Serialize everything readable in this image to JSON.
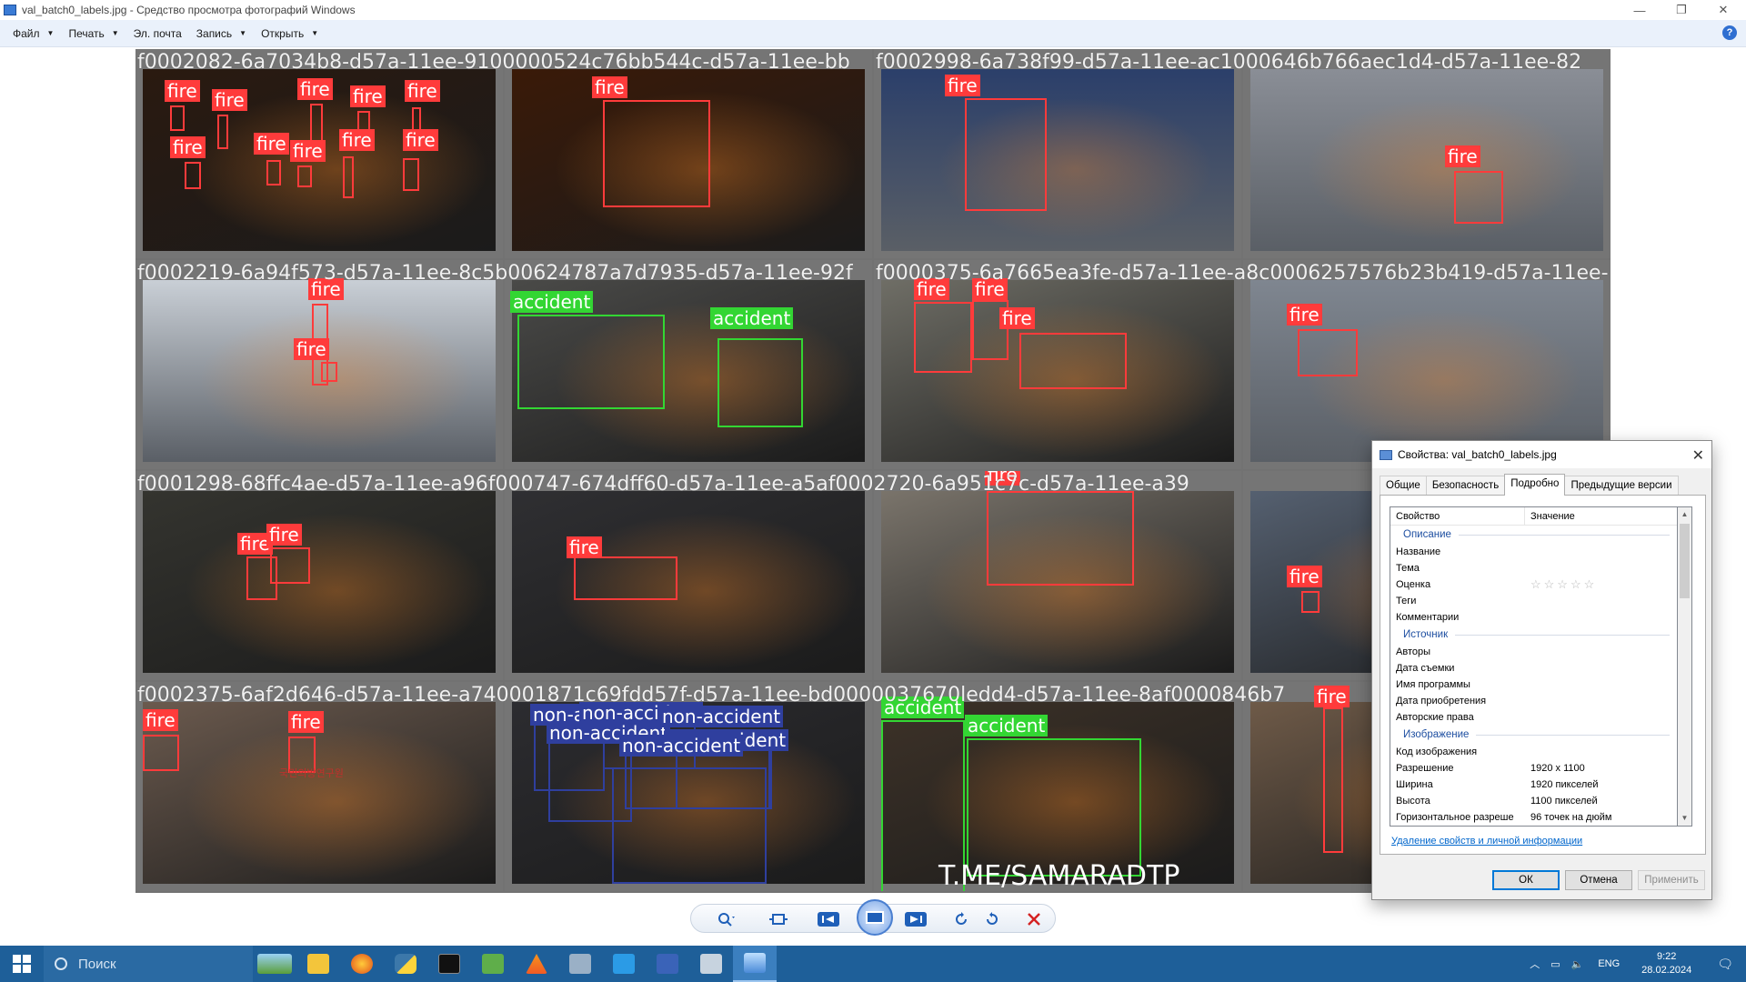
{
  "window": {
    "title": "val_batch0_labels.jpg - Средство просмотра фотографий Windows",
    "minimize": "—",
    "restore": "❐",
    "close": "✕"
  },
  "menu": {
    "items": [
      "Файл",
      "Печать",
      "Эл. почта",
      "Запись",
      "Открыть"
    ],
    "help": "?"
  },
  "mosaic": {
    "tiles": [
      {
        "caption": "f0002082-6a7034b8-d57a-11ee-9100000524c76bb544c-d57a-11ee-bb",
        "scene": "#2a1a10",
        "labels": [
          {
            "text": "fire",
            "cls": "fire"
          },
          {
            "text": "fire",
            "cls": "fire"
          },
          {
            "text": "fire",
            "cls": "fire"
          },
          {
            "text": "fire",
            "cls": "fire"
          },
          {
            "text": "fire",
            "cls": "fire"
          },
          {
            "text": "fire",
            "cls": "fire"
          },
          {
            "text": "fire",
            "cls": "fire"
          },
          {
            "text": "fire",
            "cls": "fire"
          },
          {
            "text": "fire",
            "cls": "fire"
          },
          {
            "text": "fire",
            "cls": "fire"
          }
        ]
      },
      {
        "caption": "",
        "scene": "#3a1a08",
        "labels": [
          {
            "text": "fire",
            "cls": "fire"
          }
        ]
      },
      {
        "caption": "f0002998-6a738f99-d57a-11ee-ac1000646b766aec1d4-d57a-11ee-82",
        "scene": "#2b3f6a",
        "labels": [
          {
            "text": "fire",
            "cls": "fire"
          }
        ]
      },
      {
        "caption": "",
        "scene": "#8a8e96",
        "labels": [
          {
            "text": "fire",
            "cls": "fire"
          }
        ]
      },
      {
        "caption": "f0002219-6a94f573-d57a-11ee-8c5b00624787a7d7935-d57a-11ee-92f",
        "scene": "#c9cfd6",
        "labels": [
          {
            "text": "fire",
            "cls": "fire"
          },
          {
            "text": "fire",
            "cls": "fire"
          }
        ]
      },
      {
        "caption": "",
        "scene": "#4a4a48",
        "labels": [
          {
            "text": "accident",
            "cls": "accident"
          },
          {
            "text": "accident",
            "cls": "accident"
          }
        ]
      },
      {
        "caption": "f0000375-6a7665ea3fe-d57a-11ee-a8c0006257576b23b419-d57a-11ee-aa",
        "scene": "#6f6e66",
        "labels": [
          {
            "text": "fire",
            "cls": "fire"
          },
          {
            "text": "fire",
            "cls": "fire"
          },
          {
            "text": "fire",
            "cls": "fire"
          }
        ]
      },
      {
        "caption": "",
        "scene": "#7f8690",
        "labels": [
          {
            "text": "fire",
            "cls": "fire"
          }
        ]
      },
      {
        "caption": "f0001298-68ffc4ae-d57a-11ee-a96f000747-674dff60-d57a-11ee-a5af0002720-6a951c7c-d57a-11ee-a39",
        "scene": "#34342f",
        "labels": [
          {
            "text": "fire",
            "cls": "fire"
          },
          {
            "text": "fire",
            "cls": "fire"
          }
        ]
      },
      {
        "caption": "",
        "scene": "#2f2f32",
        "labels": [
          {
            "text": "fire",
            "cls": "fire"
          }
        ]
      },
      {
        "caption": "",
        "scene": "#7a746b",
        "labels": [
          {
            "text": "fire",
            "cls": "fire"
          }
        ]
      },
      {
        "caption": "",
        "scene": "#556070",
        "labels": [
          {
            "text": "fire",
            "cls": "fire"
          }
        ]
      },
      {
        "caption": "f0002375-6af2d646-d57a-11ee-a740001871c69fdd57f-d57a-11ee-bd0000037670ledd4-d57a-11ee-8af0000846b7",
        "scene": "#6b5a4e",
        "labels": [
          {
            "text": "fire",
            "cls": "fire"
          },
          {
            "text": "fire",
            "cls": "fire"
          }
        ]
      },
      {
        "caption": "",
        "scene": "#2c2c30",
        "labels": [
          {
            "text": "non-accident",
            "cls": "non"
          },
          {
            "text": "non-accident",
            "cls": "non"
          },
          {
            "text": "non-accident",
            "cls": "non"
          },
          {
            "text": "non-accident",
            "cls": "non"
          },
          {
            "text": "non-accident",
            "cls": "non"
          },
          {
            "text": "non-accident",
            "cls": "non"
          }
        ]
      },
      {
        "caption": "",
        "scene": "#3d3228",
        "labels": [
          {
            "text": "accident",
            "cls": "accident"
          },
          {
            "text": "accident",
            "cls": "accident"
          }
        ]
      },
      {
        "caption": "",
        "scene": "#6e5a48",
        "labels": [
          {
            "text": "fire",
            "cls": "fire"
          }
        ]
      }
    ],
    "watermark": "T.ME/SAMARADTP",
    "sign": "국민의방연구원"
  },
  "toolbar": {
    "zoom": "zoom-icon",
    "fit": "fit-icon",
    "prev": "prev-icon",
    "slideshow": "slideshow-icon",
    "next": "next-icon",
    "rotate_left": "rotate-left-icon",
    "rotate_right": "rotate-right-icon",
    "delete": "delete-icon"
  },
  "dialog": {
    "title": "Свойства: val_batch0_labels.jpg",
    "tabs": [
      "Общие",
      "Безопасность",
      "Подробно",
      "Предыдущие версии"
    ],
    "active_tab": "Подробно",
    "columns": [
      "Свойство",
      "Значение"
    ],
    "sections": [
      {
        "name": "Описание",
        "rows": [
          {
            "k": "Название",
            "v": ""
          },
          {
            "k": "Тема",
            "v": ""
          },
          {
            "k": "Оценка",
            "v": "☆☆☆☆☆"
          },
          {
            "k": "Теги",
            "v": ""
          },
          {
            "k": "Комментарии",
            "v": ""
          }
        ]
      },
      {
        "name": "Источник",
        "rows": [
          {
            "k": "Авторы",
            "v": ""
          },
          {
            "k": "Дата съемки",
            "v": ""
          },
          {
            "k": "Имя программы",
            "v": ""
          },
          {
            "k": "Дата приобретения",
            "v": ""
          },
          {
            "k": "Авторские права",
            "v": ""
          }
        ]
      },
      {
        "name": "Изображение",
        "rows": [
          {
            "k": "Код изображения",
            "v": ""
          },
          {
            "k": "Разрешение",
            "v": "1920 x 1100"
          },
          {
            "k": "Ширина",
            "v": "1920 пикселей"
          },
          {
            "k": "Высота",
            "v": "1100 пикселей"
          },
          {
            "k": "Горизонтальное разреше",
            "v": "96 точек на дюйм"
          }
        ]
      }
    ],
    "link": "Удаление свойств и личной информации",
    "buttons": {
      "ok": "ОК",
      "cancel": "Отмена",
      "apply": "Применить"
    }
  },
  "taskbar": {
    "search_placeholder": "Поиск",
    "lang": "ENG",
    "time": "9:22",
    "date": "28.02.2024"
  },
  "colors": {
    "fire": "#ff3b3b",
    "accident": "#33d633",
    "non": "#2f3f9e",
    "accent": "#1f5fb8"
  }
}
